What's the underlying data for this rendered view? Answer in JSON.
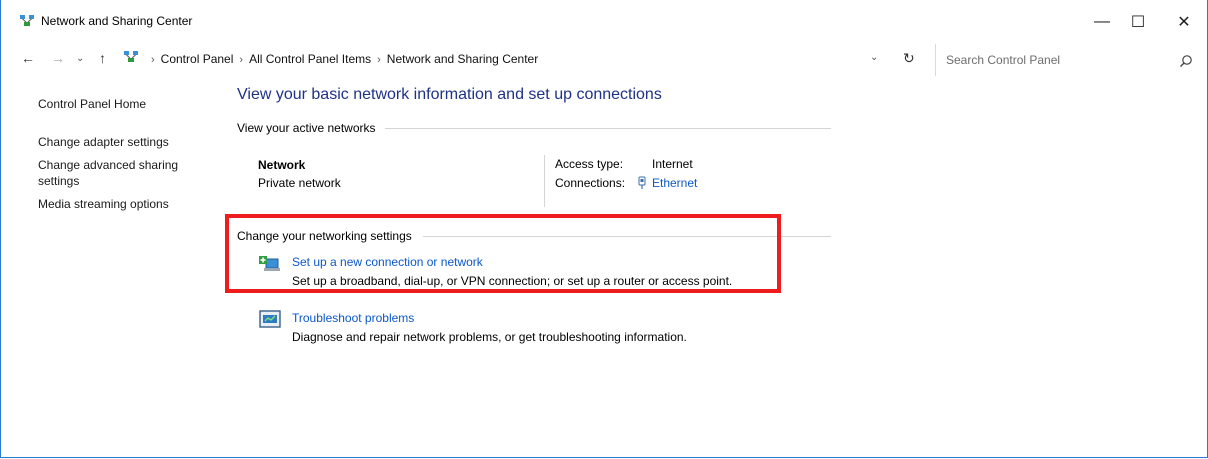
{
  "window": {
    "title": "Network and Sharing Center",
    "minimize_glyph": "—",
    "maximize_glyph": "☐",
    "close_glyph": "✕"
  },
  "address_bar": {
    "back_glyph": "←",
    "forward_glyph": "→",
    "recent_glyph": "⌄",
    "up_glyph": "↑",
    "breadcrumbs": [
      "Control Panel",
      "All Control Panel Items",
      "Network and Sharing Center"
    ],
    "separator": "›",
    "dropdown_glyph": "⌄",
    "refresh_glyph": "↻",
    "search_placeholder": "Search Control Panel"
  },
  "sidebar": {
    "items": [
      {
        "label": "Control Panel Home"
      },
      {
        "label": "Change adapter settings"
      },
      {
        "label": "Change advanced sharing settings"
      },
      {
        "label": "Media streaming options"
      }
    ]
  },
  "main": {
    "heading": "View your basic network information and set up connections",
    "active_networks_label": "View your active networks",
    "network": {
      "name": "Network",
      "type": "Private network",
      "access_type_label": "Access type:",
      "access_type_value": "Internet",
      "connections_label": "Connections:",
      "connections_value": "Ethernet"
    },
    "networking_settings_label": "Change your networking settings",
    "tasks": [
      {
        "title": "Set up a new connection or network",
        "description": "Set up a broadband, dial-up, or VPN connection; or set up a router or access point."
      },
      {
        "title": "Troubleshoot problems",
        "description": "Diagnose and repair network problems, or get troubleshooting information."
      }
    ]
  },
  "colors": {
    "link": "#0b57c9",
    "heading": "#1e3287",
    "highlight": "#ee1c1c"
  }
}
